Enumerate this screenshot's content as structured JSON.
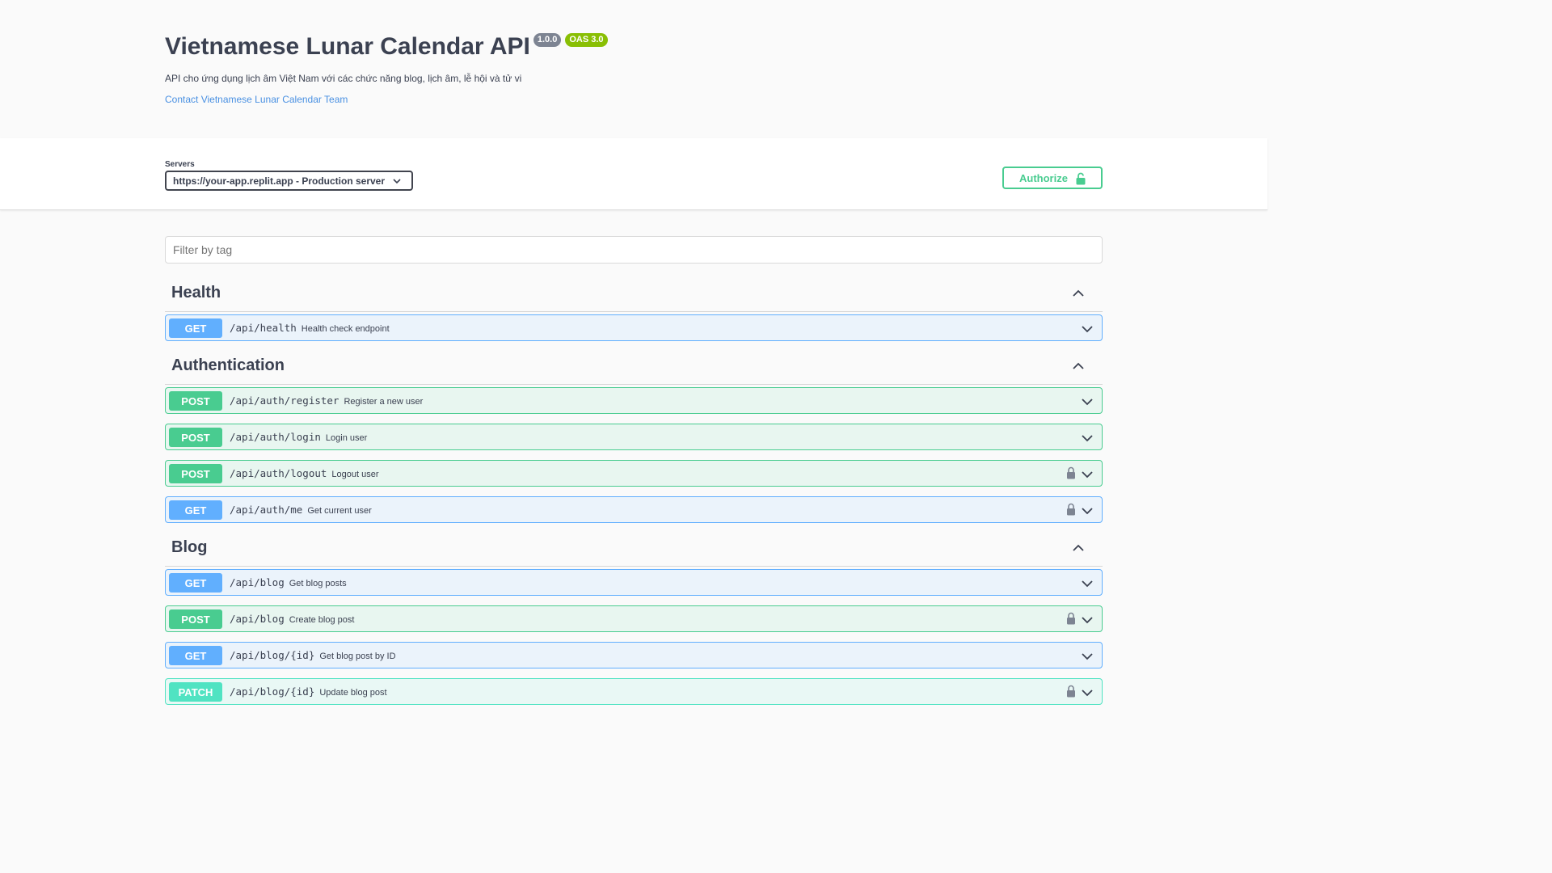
{
  "info": {
    "title": "Vietnamese Lunar Calendar API",
    "version": "1.0.0",
    "oas": "OAS 3.0",
    "description": "API cho ứng dụng lịch âm Việt Nam với các chức năng blog, lịch âm, lễ hội và tử vi",
    "contact": "Contact Vietnamese Lunar Calendar Team"
  },
  "servers": {
    "label": "Servers",
    "selected": "https://your-app.replit.app - Production server"
  },
  "authorize": {
    "label": "Authorize"
  },
  "filter": {
    "placeholder": "Filter by tag"
  },
  "tags": [
    {
      "name": "Health",
      "operations": [
        {
          "method": "GET",
          "path": "/api/health",
          "summary": "Health check endpoint",
          "locked": false
        }
      ]
    },
    {
      "name": "Authentication",
      "operations": [
        {
          "method": "POST",
          "path": "/api/auth/register",
          "summary": "Register a new user",
          "locked": false
        },
        {
          "method": "POST",
          "path": "/api/auth/login",
          "summary": "Login user",
          "locked": false
        },
        {
          "method": "POST",
          "path": "/api/auth/logout",
          "summary": "Logout user",
          "locked": true
        },
        {
          "method": "GET",
          "path": "/api/auth/me",
          "summary": "Get current user",
          "locked": true
        }
      ]
    },
    {
      "name": "Blog",
      "operations": [
        {
          "method": "GET",
          "path": "/api/blog",
          "summary": "Get blog posts",
          "locked": false
        },
        {
          "method": "POST",
          "path": "/api/blog",
          "summary": "Create blog post",
          "locked": true
        },
        {
          "method": "GET",
          "path": "/api/blog/{id}",
          "summary": "Get blog post by ID",
          "locked": false
        },
        {
          "method": "PATCH",
          "path": "/api/blog/{id}",
          "summary": "Update blog post",
          "locked": true
        }
      ]
    }
  ],
  "colors": {
    "get": "#61affe",
    "post": "#49cc90",
    "patch": "#50e3c2",
    "link": "#4990e2"
  }
}
